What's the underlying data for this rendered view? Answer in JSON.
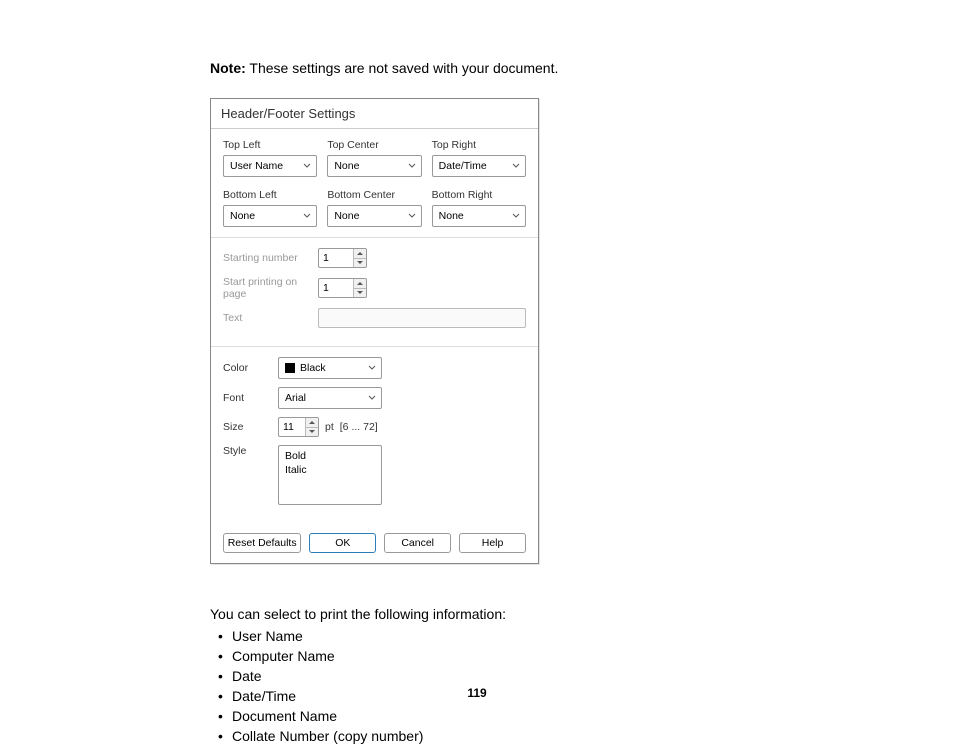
{
  "note": {
    "label": "Note:",
    "text": " These settings are not saved with your document."
  },
  "dialog": {
    "title": "Header/Footer Settings",
    "positions": {
      "top_left": {
        "label": "Top Left",
        "value": "User Name"
      },
      "top_center": {
        "label": "Top Center",
        "value": "None"
      },
      "top_right": {
        "label": "Top Right",
        "value": "Date/Time"
      },
      "bottom_left": {
        "label": "Bottom Left",
        "value": "None"
      },
      "bottom_center": {
        "label": "Bottom Center",
        "value": "None"
      },
      "bottom_right": {
        "label": "Bottom Right",
        "value": "None"
      }
    },
    "starting_number": {
      "label": "Starting number",
      "value": "1"
    },
    "start_printing": {
      "label": "Start printing on page",
      "value": "1"
    },
    "text_field": {
      "label": "Text",
      "value": ""
    },
    "color": {
      "label": "Color",
      "value": "Black"
    },
    "font": {
      "label": "Font",
      "value": "Arial"
    },
    "size": {
      "label": "Size",
      "value": "11",
      "unit": "pt",
      "range": "[6 ... 72]"
    },
    "style": {
      "label": "Style",
      "options": [
        "Bold",
        "Italic"
      ]
    },
    "buttons": {
      "reset": "Reset Defaults",
      "ok": "OK",
      "cancel": "Cancel",
      "help": "Help"
    }
  },
  "below": {
    "intro": "You can select to print the following information:",
    "items": [
      "User Name",
      "Computer Name",
      "Date",
      "Date/Time",
      "Document Name",
      "Collate Number (copy number)"
    ]
  },
  "page_number": "119"
}
